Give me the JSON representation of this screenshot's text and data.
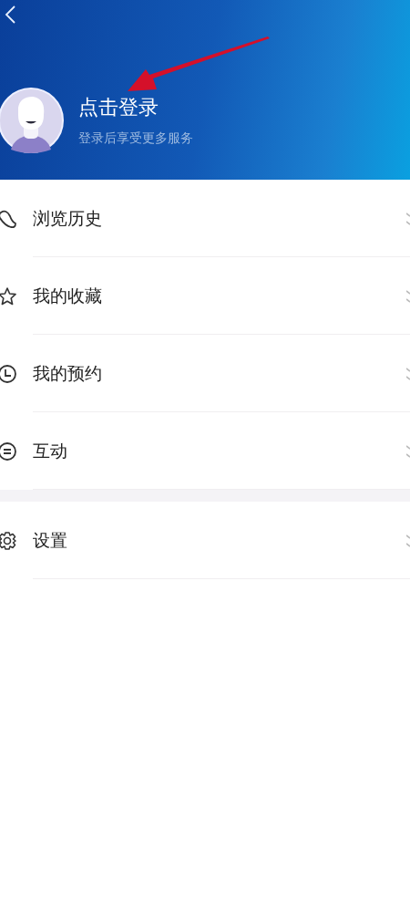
{
  "header": {
    "title": "点击登录",
    "subtitle": "登录后享受更多服务"
  },
  "menu_groups": [
    [
      {
        "label": "浏览历史"
      },
      {
        "label": "我的收藏"
      },
      {
        "label": "我的预约"
      },
      {
        "label": "互动"
      }
    ],
    [
      {
        "label": "设置"
      }
    ]
  ]
}
